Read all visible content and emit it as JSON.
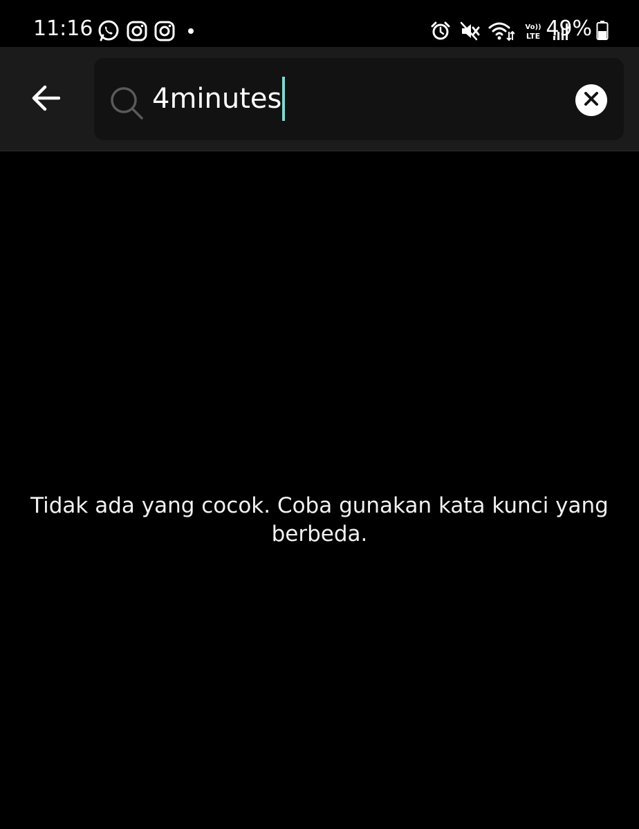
{
  "status_bar": {
    "time": "11:16",
    "battery_percent": "49%",
    "network_label": "Vo)) LTE",
    "left_icons": [
      "whatsapp-icon",
      "instagram-icon",
      "instagram-icon",
      "notification-dot"
    ],
    "right_icons": [
      "alarm-icon",
      "mute-icon",
      "wifi-icon",
      "volte-icon",
      "signal-icon",
      "battery-icon"
    ]
  },
  "search": {
    "query": "4minutes",
    "back_icon": "arrow-left-icon",
    "search_icon": "search-icon",
    "clear_icon": "clear-icon"
  },
  "results": {
    "empty_message": "Tidak ada yang cocok. Coba gunakan kata kunci yang berbeda."
  },
  "colors": {
    "background": "#000000",
    "header": "#1b1b1b",
    "search_box": "#121212",
    "caret": "#7fd8d4",
    "text": "#ffffff"
  }
}
